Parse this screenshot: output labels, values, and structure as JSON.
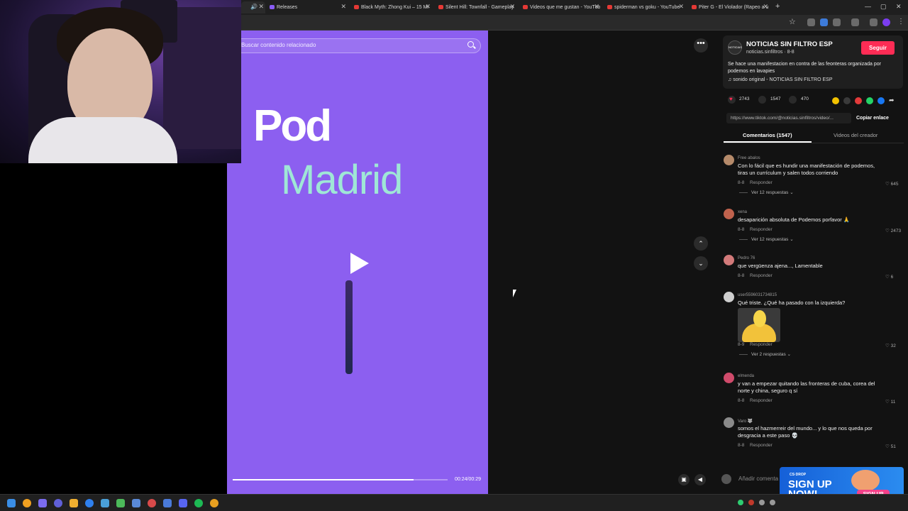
{
  "browser": {
    "tabs": [
      {
        "label": "Releases"
      },
      {
        "label": "Black Myth: Zhong Kui – 15 Mi"
      },
      {
        "label": "Silent Hill: Townfall - Gameplay"
      },
      {
        "label": "Videos que me gustan - YouTub"
      },
      {
        "label": "spiderman vs goku - YouTube"
      },
      {
        "label": "Piter G - El Violador (Rapeo a u"
      }
    ],
    "new_tab": "+",
    "window_controls": [
      "—",
      "▢",
      "✕"
    ]
  },
  "video": {
    "search_placeholder": "Buscar contenido relacionado",
    "overlay_line1": "Pod",
    "overlay_line2": "Madrid",
    "progress_fraction": 0.84,
    "time": "00:24/00:29"
  },
  "player_controls": {
    "more": "•••",
    "prev": "⌃",
    "next": "⌄"
  },
  "author": {
    "avatar_text": "NOTICIAS",
    "name": "NOTICIAS SIN FILTRO ESP",
    "handle": "noticias.sinfiltros · 8-8",
    "follow_label": "Seguir",
    "description": "Se hace una manifestacion en contra de las feonteras organizada por podemos en lavapies",
    "sound": "♫  sonido original - NOTICIAS SIN FILTRO ESP"
  },
  "stats": {
    "likes": "2743",
    "comments": "1547",
    "saves": "470"
  },
  "link": {
    "url": "https://www.tiktok.com/@noticias.sinfiltros/video/...",
    "copy_label": "Copiar enlace"
  },
  "tabs": {
    "comments": "Comentarios (1547)",
    "creator": "Videos del creador"
  },
  "comments": [
    {
      "user": "Free abalos",
      "text": "Con lo fácil que es hundir una manifestación de podemos, tiras un currículum y salen todos corriendo",
      "date": "8-8",
      "reply": "Responder",
      "likes": "♡ 645",
      "more": "Ver 12 respuestas ⌄",
      "avatar_color": "#b58a6a"
    },
    {
      "user": "xena",
      "text": "desaparición absoluta de Podemos porfavor 🙏",
      "date": "8-8",
      "reply": "Responder",
      "likes": "♡ 2473",
      "more": "Ver 12 respuestas ⌄",
      "avatar_color": "#c0624d"
    },
    {
      "user": "Pedro 76",
      "text": "que vergüenza ajena..., Lamentable",
      "date": "8-8",
      "reply": "Responder",
      "likes": "♡ 6",
      "more": "",
      "avatar_color": "#d27a7a"
    },
    {
      "user": "user5596031734815",
      "text": "Qué triste. ¿Qué ha pasado con la izquierda?",
      "date": "8-9",
      "reply": "Responder",
      "likes": "♡ 32",
      "more": "Ver 2 respuestas ⌄",
      "avatar_color": "#cfcfcf"
    },
    {
      "user": "elmenda",
      "text": "y van a empezar quitando las fronteras de cuba, corea del norte y china, seguro q sí",
      "date": "8-8",
      "reply": "Responder",
      "likes": "♡ 11",
      "more": "",
      "avatar_color": "#d04b6b"
    },
    {
      "user": "Varo 🐺",
      "text": "somos el hazmerreir del mundo... y lo que nos queda por desgracia a este paso 💀",
      "date": "8-8",
      "reply": "Responder",
      "likes": "♡ 51",
      "more": "",
      "avatar_color": "#8a8a8a"
    }
  ],
  "add_comment_placeholder": "Añadir comenta",
  "ad": {
    "brand": "CS·DROP",
    "title_line1": "SIGN UP",
    "title_line2": "NOW!",
    "button": "SIGN UP"
  }
}
